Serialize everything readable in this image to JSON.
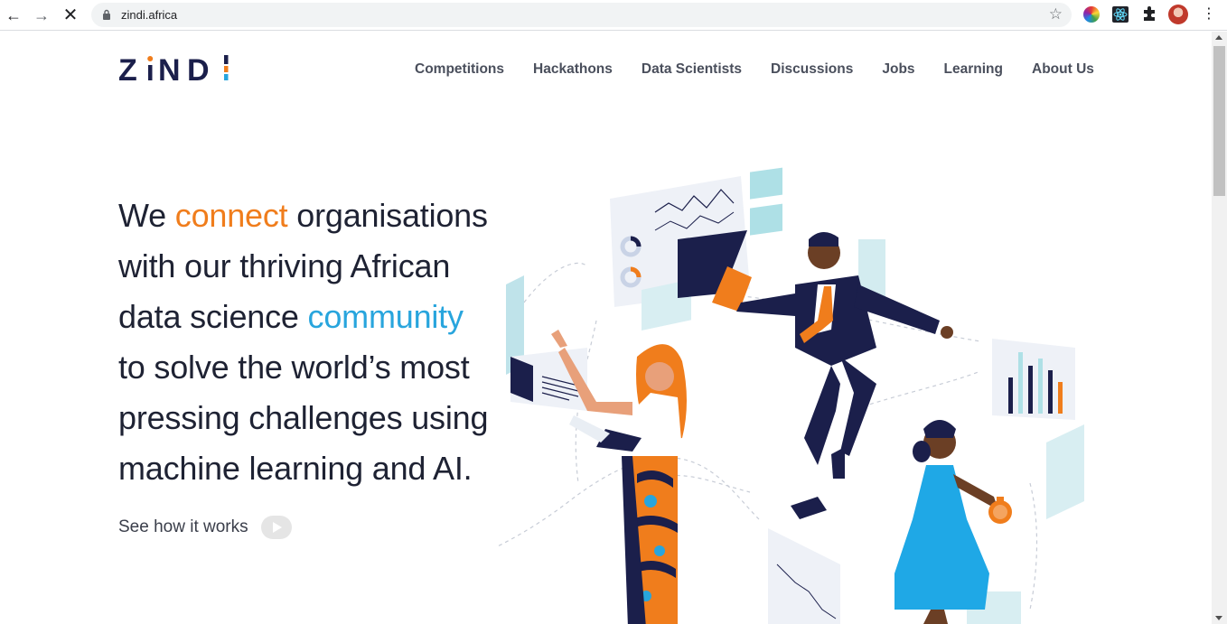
{
  "browser": {
    "url": "zindi.africa",
    "back_icon": "←",
    "forward_icon": "→",
    "stop_icon": "✕",
    "star_icon": "☆",
    "menu_icon": "⋮"
  },
  "header": {
    "logo": "ZiNDi",
    "nav": [
      {
        "label": "Competitions"
      },
      {
        "label": "Hackathons"
      },
      {
        "label": "Data Scientists"
      },
      {
        "label": "Discussions"
      },
      {
        "label": "Jobs"
      },
      {
        "label": "Learning"
      },
      {
        "label": "About Us"
      }
    ]
  },
  "hero": {
    "part1": "We ",
    "highlight1": "connect",
    "part2": " organisations with our thriving African data science ",
    "highlight2": "community",
    "part3": " to solve the world’s most pressing challenges using machine learning and AI.",
    "cta_label": "See how it works"
  },
  "colors": {
    "orange": "#f07d1c",
    "blue": "#28a5dd",
    "navy": "#1b1f4b"
  }
}
